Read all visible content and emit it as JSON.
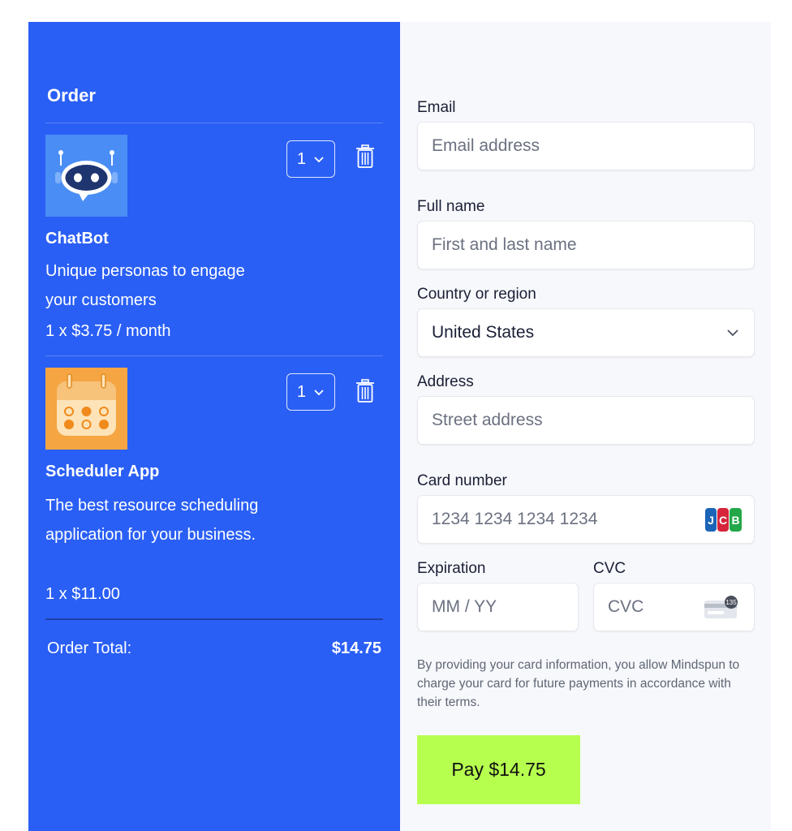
{
  "order": {
    "title": "Order",
    "items": [
      {
        "name": "ChatBot",
        "description": "Unique personas to engage your customers",
        "price": "1 x $3.75 / month",
        "quantity": "1",
        "icon": "chatbot-robot-icon",
        "image_bg": "#4a8ef5"
      },
      {
        "name": "Scheduler App",
        "description": "The best resource scheduling application for your business.",
        "price": "1 x $11.00",
        "quantity": "1",
        "icon": "calendar-icon",
        "image_bg": "#f5a542"
      }
    ],
    "total_label": "Order Total:",
    "total_value": "$14.75"
  },
  "checkout": {
    "email_label": "Email",
    "email_placeholder": "Email address",
    "name_label": "Full name",
    "name_placeholder": "First and last name",
    "country_label": "Country or region",
    "country_value": "United States",
    "address_label": "Address",
    "address_placeholder": "Street address",
    "card_label": "Card number",
    "card_placeholder": "1234 1234 1234 1234",
    "card_brand_icon": "jcb-card-icon",
    "expiration_label": "Expiration",
    "expiration_placeholder": "MM / YY",
    "cvc_label": "CVC",
    "cvc_placeholder": "CVC",
    "cvc_icon": "cvc-card-icon",
    "cvc_icon_text": "135",
    "legal_text": "By providing your card information, you allow Mindspun to charge your card for future payments in accordance with their terms.",
    "pay_label": "Pay $14.75"
  },
  "colors": {
    "order_panel_bg": "#2a5ff5",
    "checkout_bg": "#f7f8fb",
    "pay_button_bg": "#b6ff4f"
  }
}
